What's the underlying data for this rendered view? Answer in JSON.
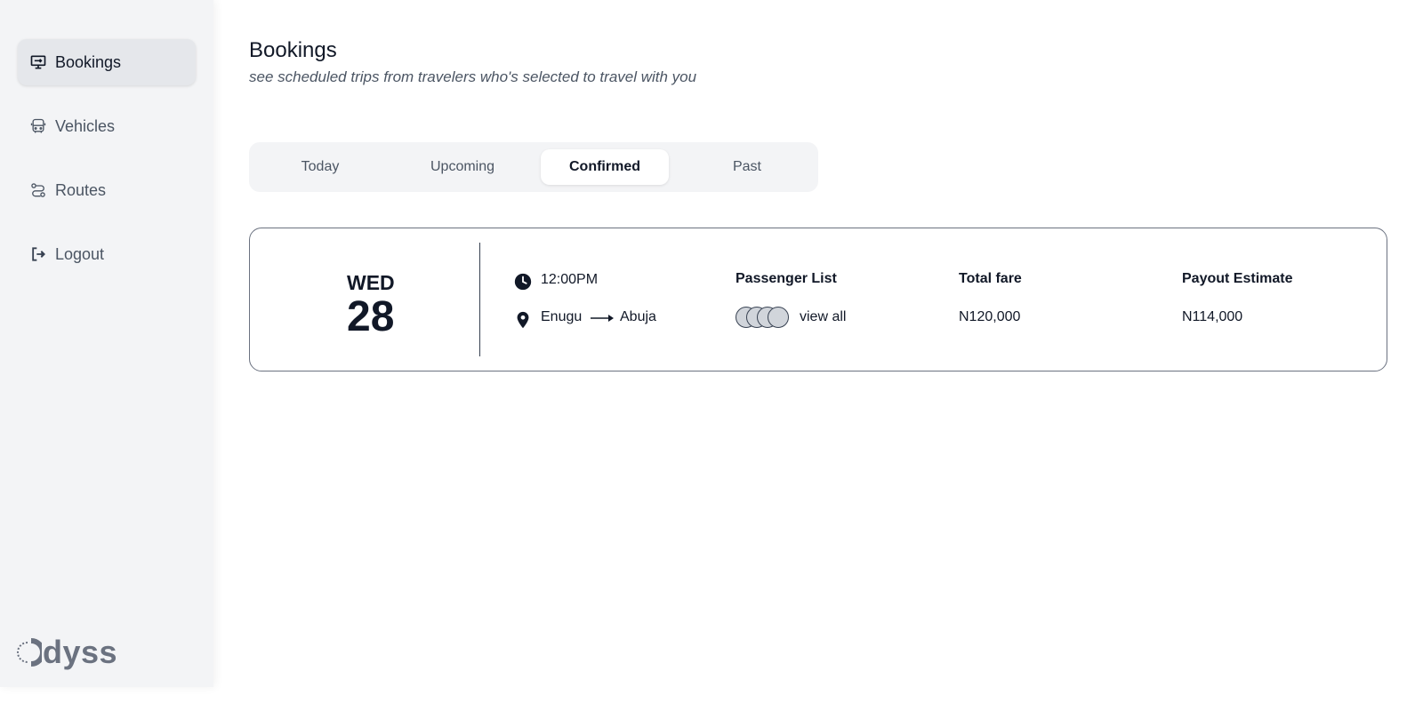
{
  "sidebar": {
    "items": [
      {
        "label": "Bookings",
        "icon": "monitor-icon"
      },
      {
        "label": "Vehicles",
        "icon": "bus-icon"
      },
      {
        "label": "Routes",
        "icon": "route-icon"
      },
      {
        "label": "Logout",
        "icon": "logout-icon"
      }
    ],
    "active_index": 0,
    "logo_text": "dyss"
  },
  "header": {
    "title": "Bookings",
    "subtitle": "see scheduled trips from travelers who's selected to travel with you"
  },
  "tabs": {
    "items": [
      {
        "label": "Today"
      },
      {
        "label": "Upcoming"
      },
      {
        "label": "Confirmed"
      },
      {
        "label": "Past"
      }
    ],
    "active_index": 2
  },
  "booking": {
    "day": "WED",
    "date": "28",
    "time": "12:00PM",
    "origin": "Enugu",
    "destination": "Abuja",
    "passenger_list_label": "Passenger List",
    "view_all_label": "view all",
    "total_fare_label": "Total fare",
    "total_fare": "N120,000",
    "payout_label": "Payout Estimate",
    "payout": "N114,000"
  },
  "colors": {
    "sidebar_bg": "#f3f4f6",
    "active_bg": "#e5e7eb",
    "text_primary": "#111827",
    "text_muted": "#4b5563",
    "card_border": "#6b7280"
  }
}
